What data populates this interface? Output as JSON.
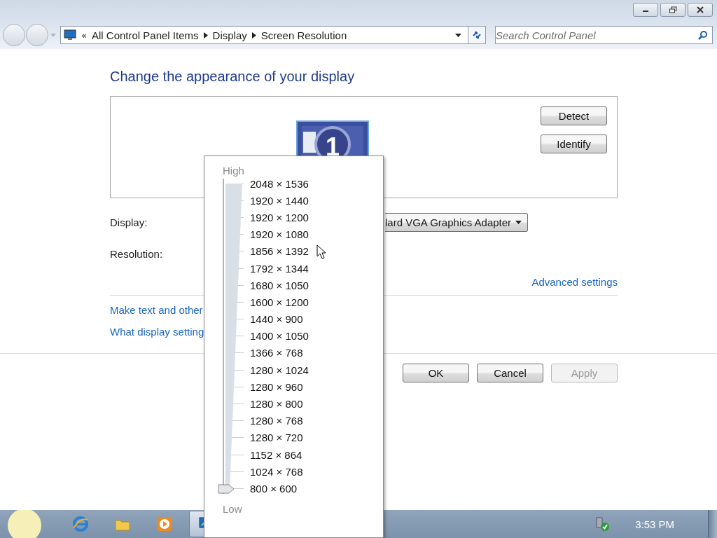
{
  "address_bar": {
    "chevron": "«",
    "crumbs": [
      "All Control Panel Items",
      "Display",
      "Screen Resolution"
    ]
  },
  "search": {
    "placeholder": "Search Control Panel"
  },
  "heading": "Change the appearance of your display",
  "monitor": {
    "label": "1"
  },
  "side_buttons": [
    "Detect",
    "Identify"
  ],
  "display": {
    "label": "Display:",
    "value": "lard VGA Graphics Adapter"
  },
  "resolution": {
    "label": "Resolution:"
  },
  "advanced_link": "Advanced settings",
  "links": [
    "Make text and other",
    "What display setting"
  ],
  "dialog_buttons": [
    {
      "label": "OK",
      "disabled": false
    },
    {
      "label": "Cancel",
      "disabled": false
    },
    {
      "label": "Apply",
      "disabled": true
    }
  ],
  "resolution_menu": {
    "top_label": "High",
    "bottom_label": "Low",
    "slider": {
      "level": 0
    },
    "options": [
      "2048 × 1536",
      "1920 × 1440",
      "1920 × 1200",
      "1920 × 1080",
      "1856 × 1392",
      "1792 × 1344",
      "1680 × 1050",
      "1600 × 1200",
      "1440 × 900",
      "1400 × 1050",
      "1366 × 768",
      "1280 × 1024",
      "1280 × 960",
      "1280 × 800",
      "1280 × 768",
      "1280 × 720",
      "1152 × 864",
      "1024 × 768",
      "800 × 600"
    ]
  },
  "taskbar": {
    "pinned": [
      {
        "kind": "browser",
        "selected": false
      },
      {
        "kind": "folder",
        "selected": false
      },
      {
        "kind": "media",
        "selected": false
      },
      {
        "kind": "display",
        "selected": true
      }
    ],
    "clock": "3:53 PM"
  }
}
